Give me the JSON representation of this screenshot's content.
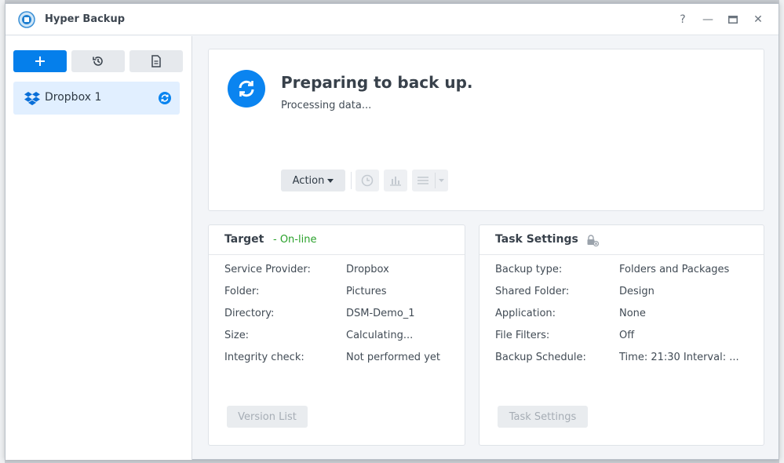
{
  "window": {
    "title": "Hyper Backup"
  },
  "window_controls": {
    "help": "?",
    "minimize": "—",
    "maximize": "▭",
    "close": "✕"
  },
  "sidebar": {
    "buttons": [
      {
        "icon": "plus-icon"
      },
      {
        "icon": "history-icon"
      },
      {
        "icon": "log-icon"
      }
    ],
    "tasks": [
      {
        "label": "Dropbox 1",
        "provider_icon": "dropbox-icon",
        "status_icon": "sync-icon"
      }
    ]
  },
  "status": {
    "title": "Preparing to back up.",
    "subtitle": "Processing data...",
    "action_label": "Action"
  },
  "target": {
    "title": "Target",
    "status": "- On-line",
    "rows": [
      {
        "label": "Service Provider:",
        "value": "Dropbox"
      },
      {
        "label": "Folder:",
        "value": "Pictures"
      },
      {
        "label": "Directory:",
        "value": "DSM-Demo_1"
      },
      {
        "label": "Size:",
        "value": "Calculating..."
      },
      {
        "label": "Integrity check:",
        "value": "Not performed yet"
      }
    ],
    "button_label": "Version List"
  },
  "task_settings": {
    "title": "Task Settings",
    "rows": [
      {
        "label": "Backup type:",
        "value": "Folders and Packages"
      },
      {
        "label": "Shared Folder:",
        "value": "Design"
      },
      {
        "label": "Application:",
        "value": "None"
      },
      {
        "label": "File Filters:",
        "value": "Off"
      },
      {
        "label": "Backup Schedule:",
        "value": "Time: 21:30 Interval: ..."
      }
    ],
    "button_label": "Task Settings"
  },
  "colors": {
    "accent": "#057feb",
    "online": "#2aa12b",
    "selected": "#e1efff"
  }
}
